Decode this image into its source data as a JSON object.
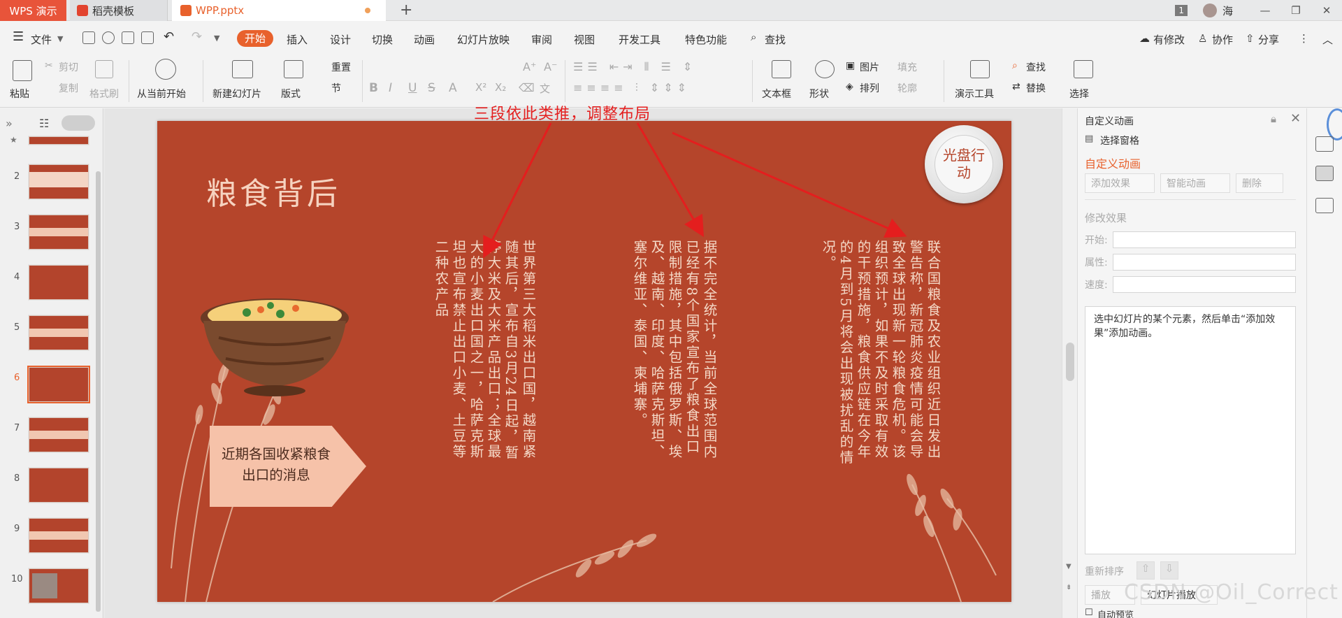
{
  "titlebar": {
    "app_tab": "WPS 演示",
    "template_tab": "稻壳模板",
    "doc_tab": "WPP.pptx",
    "page_badge": "1",
    "user": "海"
  },
  "menu": {
    "file": "文件",
    "items": [
      "开始",
      "插入",
      "设计",
      "切换",
      "动画",
      "幻灯片放映",
      "审阅",
      "视图",
      "开发工具",
      "特色功能"
    ],
    "search": "查找",
    "right": [
      "有修改",
      "协作",
      "分享"
    ]
  },
  "ribbon": {
    "paste": "粘贴",
    "cut": "剪切",
    "copy": "复制",
    "format_painter": "格式刷",
    "from_current": "从当前开始",
    "new_slide": "新建幻灯片",
    "layout": "版式",
    "reset": "重置",
    "section": "节",
    "font_size": "0",
    "text_box": "文本框",
    "shape": "形状",
    "picture": "图片",
    "fill": "填充",
    "arrange": "排列",
    "outline": "轮廓",
    "present_tools": "演示工具",
    "find": "查找",
    "replace": "替换",
    "select": "选择"
  },
  "thumbnails": [
    "2",
    "3",
    "4",
    "5",
    "6",
    "7",
    "8",
    "9",
    "10"
  ],
  "slide": {
    "title": "粮食背后",
    "badge": "光盘行动",
    "callout": "近期各国收紧粮食出口的消息",
    "col1": "世界第三大稻米出口国，越南紧随其后，宣布自3月24日起，暂停大米及大米产品出口；全球最大的小麦出口国之一，哈萨克斯坦也宣布禁止出口小麦、土豆等二种农产品",
    "col2": "据不完全统计，当前全球范围内已经有8个国家宣布了粮食出口限制措施，其中包括俄罗斯、埃及、越南、印度、哈萨克斯坦、塞尔维亚、泰国、柬埔寨。",
    "col3": "联合国粮食及农业组织近日发出警告称，新冠肺炎疫情可能会导致全球出现新一轮粮食危机。该组织预计，如果不及时采取有效的干预措施，粮食供应链在今年的4月到5月将会出现被扰乱的情况。"
  },
  "annotation": "三段依此类推，调整布局",
  "panel": {
    "title": "自定义动画",
    "selection_pane": "选择窗格",
    "section_title": "自定义动画",
    "add_effect": "添加效果",
    "smart_anim": "智能动画",
    "delete": "删除",
    "modify": "修改效果",
    "start_label": "开始:",
    "property_label": "属性:",
    "speed_label": "速度:",
    "hint": "选中幻灯片的某个元素，然后单击“添加效果”添加动画。",
    "reorder": "重新排序",
    "play": "播放",
    "slideshow": "幻灯片播放",
    "auto_preview": "自动预览"
  },
  "watermark": "CSDN @Oil_Correct",
  "colors": {
    "accent": "#e8612c",
    "slide_bg": "#b5452b",
    "annotation": "#e41e1e"
  }
}
